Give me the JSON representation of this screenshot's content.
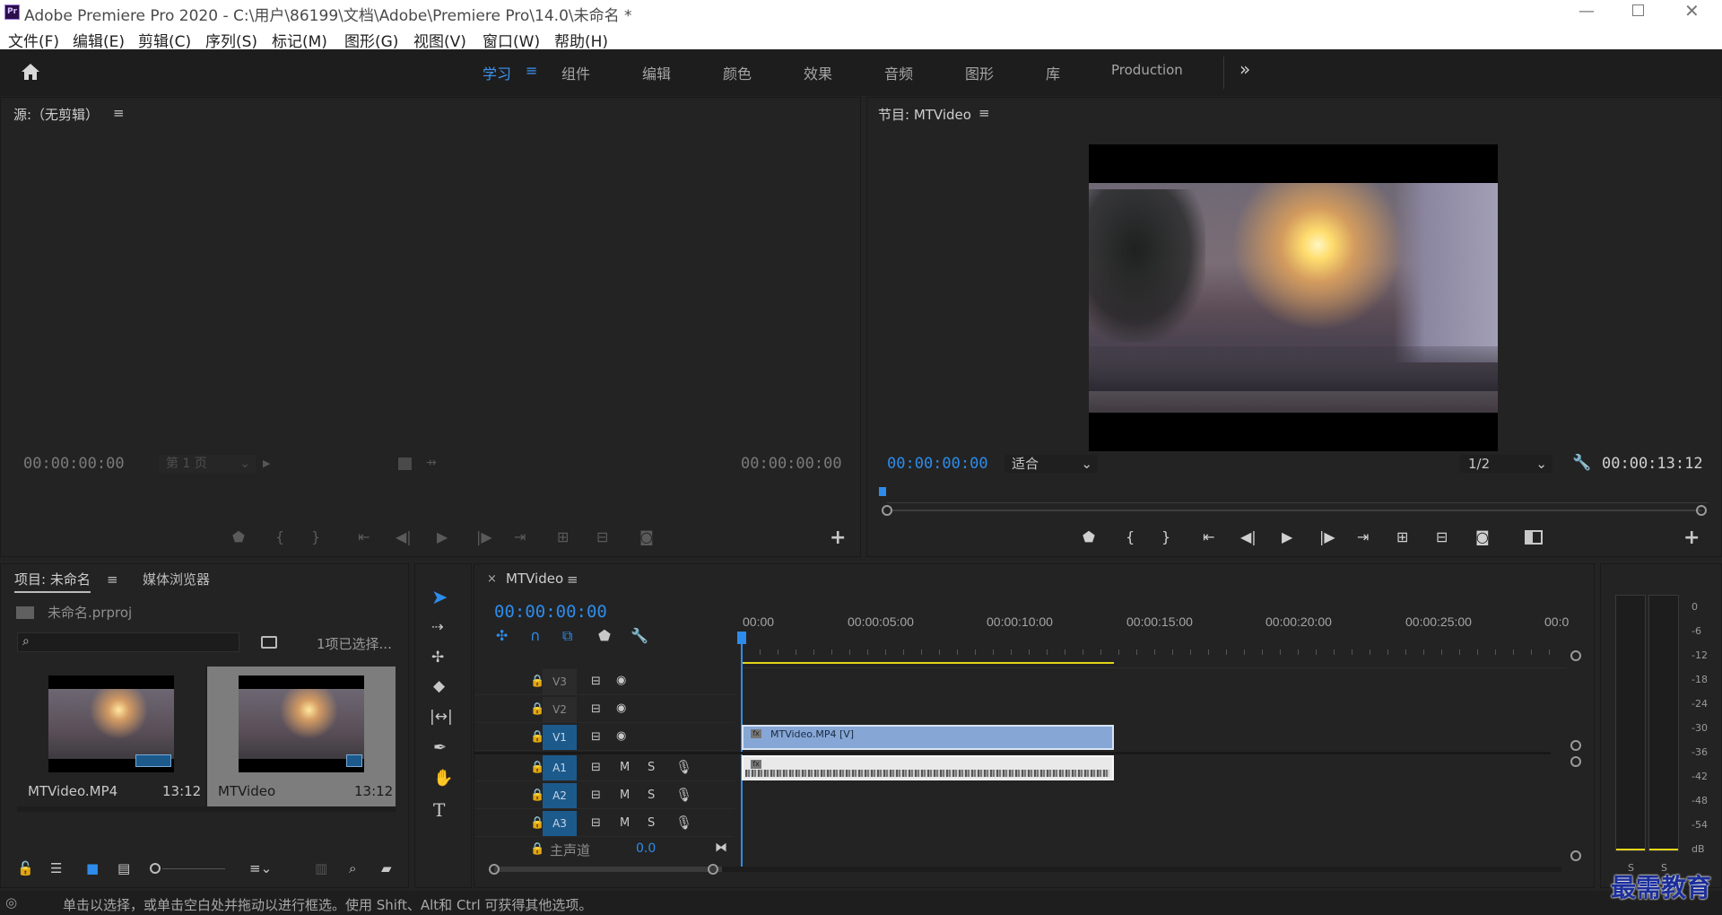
{
  "title_bar": {
    "app_title": "Adobe Premiere Pro 2020 - C:\\用户\\86199\\文档\\Adobe\\Premiere Pro\\14.0\\未命名 *"
  },
  "menu": [
    "文件(F)",
    "编辑(E)",
    "剪辑(C)",
    "序列(S)",
    "标记(M)",
    "图形(G)",
    "视图(V)",
    "窗口(W)",
    "帮助(H)"
  ],
  "workspaces": {
    "active": "学习",
    "tabs": [
      "组件",
      "颜色",
      "效果",
      "音频",
      "图形",
      "库",
      "Production"
    ],
    "edit": "编辑",
    "more": "»"
  },
  "source_monitor": {
    "title": "源:（无剪辑）",
    "timecode_in": "00:00:00:00",
    "page": "第 1 页",
    "timecode_out": "00:00:00:00"
  },
  "program_monitor": {
    "title": "节目: MTVideo",
    "timecode": "00:00:00:00",
    "fit": "适合",
    "resolution": "1/2",
    "duration": "00:00:13:12"
  },
  "project_panel": {
    "tab_project": "项目: 未命名",
    "tab_media": "媒体浏览器",
    "project_file": "未命名.prproj",
    "selection_status": "1项已选择...",
    "items": [
      {
        "name": "MTVideo.MP4",
        "duration": "13:12"
      },
      {
        "name": "MTVideo",
        "duration": "13:12"
      }
    ]
  },
  "timeline": {
    "tab_close": "×",
    "sequence_name": "MTVideo",
    "timecode": "00:00:00:00",
    "ruler": [
      "00:00",
      "00:00:05:00",
      "00:00:10:00",
      "00:00:15:00",
      "00:00:20:00",
      "00:00:25:00",
      "00:0"
    ],
    "video_tracks": [
      "V3",
      "V2",
      "V1"
    ],
    "audio_tracks": [
      "A1",
      "A2",
      "A3"
    ],
    "mute_label": "M",
    "solo_label": "S",
    "master_label": "主声道",
    "master_value": "0.0",
    "video_clip_label": "MTVideo.MP4 [V]"
  },
  "audio_meter": {
    "scale": [
      "0",
      "-6",
      "-12",
      "-18",
      "-24",
      "-30",
      "-36",
      "-42",
      "-48",
      "-54",
      "dB"
    ],
    "solo": [
      "S",
      "S"
    ]
  },
  "status_bar": {
    "hint": "单击以选择，或单击空白处并拖动以进行框选。使用 Shift、Alt和 Ctrl 可获得其他选项。"
  },
  "watermark": "最需教育",
  "colors": {
    "accent_blue": "#2d8ceb",
    "clip_video": "#86a7d6",
    "track_active": "#1c5a8c",
    "yellow_workarea": "#e3d51a"
  }
}
